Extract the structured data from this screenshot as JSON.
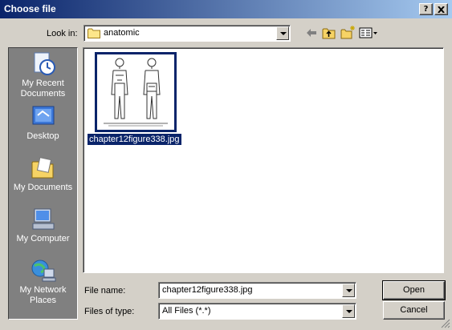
{
  "window": {
    "title": "Choose file",
    "help_button": "?",
    "close_button": "X"
  },
  "look_in": {
    "label": "Look in:",
    "value": "anatomic",
    "folder_icon": "folder-icon"
  },
  "toolbar": {
    "icons": [
      "back-arrow-icon",
      "up-folder-icon",
      "new-folder-icon",
      "view-menu-icon"
    ]
  },
  "places": [
    {
      "label": "My Recent Documents",
      "icon": "recent-documents-icon"
    },
    {
      "label": "Desktop",
      "icon": "desktop-icon"
    },
    {
      "label": "My Documents",
      "icon": "my-documents-icon"
    },
    {
      "label": "My Computer",
      "icon": "my-computer-icon"
    },
    {
      "label": "My Network Places",
      "icon": "network-places-icon"
    }
  ],
  "files": [
    {
      "name": "chapter12figure338.jpg",
      "selected": true
    }
  ],
  "file_name": {
    "label": "File name:",
    "value": "chapter12figure338.jpg"
  },
  "files_of_type": {
    "label": "Files of type:",
    "value": "All Files (*.*)"
  },
  "buttons": {
    "open": "Open",
    "cancel": "Cancel"
  },
  "colors": {
    "title_start": "#0a246a",
    "title_end": "#a6caf0",
    "dialog_bg": "#d4d0c8",
    "places_bg": "#808080",
    "selection": "#0a246a"
  }
}
